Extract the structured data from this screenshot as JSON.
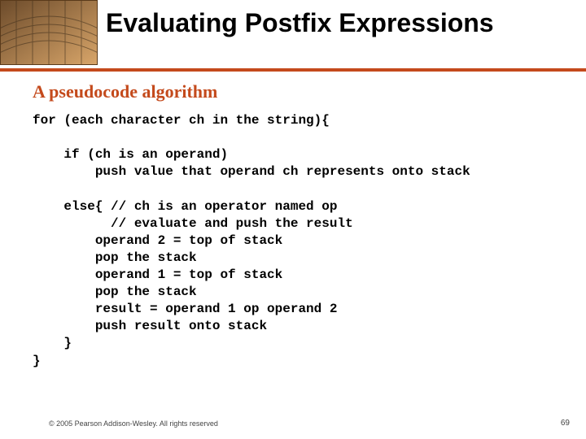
{
  "title": "Evaluating Postfix Expressions",
  "subhead": "A pseudocode algorithm",
  "code": "for (each character ch in the string){\n\n    if (ch is an operand)\n        push value that operand ch represents onto stack\n\n    else{ // ch is an operator named op\n          // evaluate and push the result\n        operand 2 = top of stack\n        pop the stack\n        operand 1 = top of stack\n        pop the stack\n        result = operand 1 op operand 2\n        push result onto stack\n    }\n}",
  "footer": "© 2005 Pearson Addison-Wesley. All rights reserved",
  "page_num": "69",
  "accent_color": "#c44a1c"
}
